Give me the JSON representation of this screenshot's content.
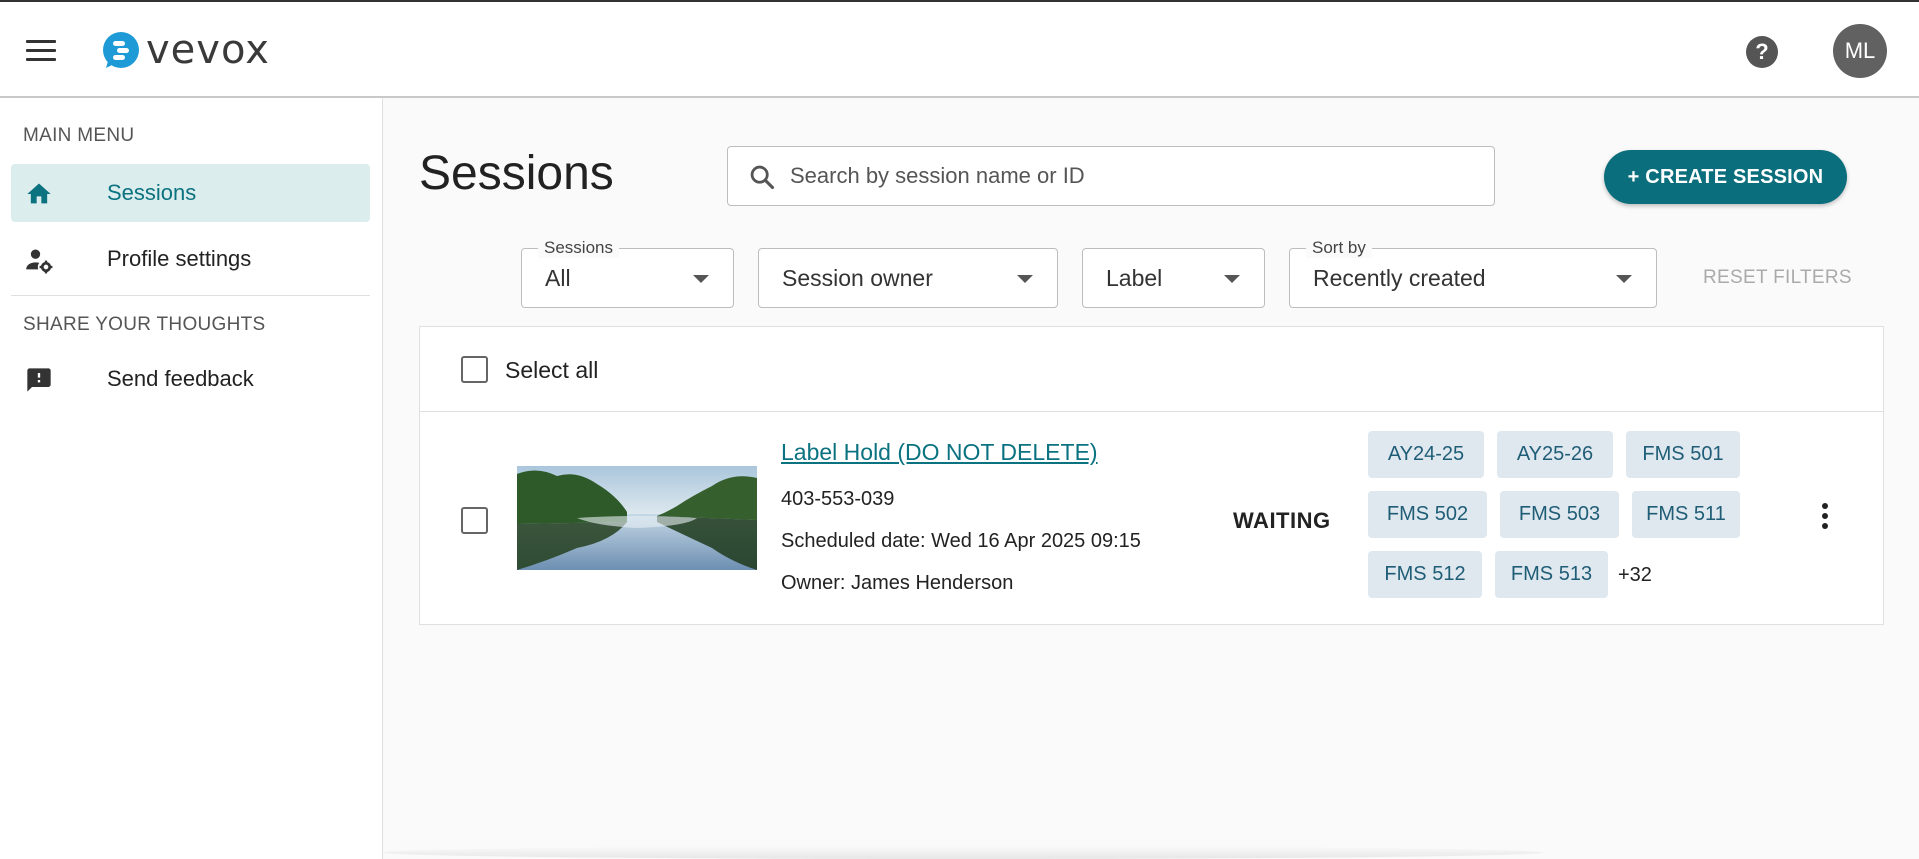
{
  "header": {
    "logo_text": "vevox",
    "help_symbol": "?",
    "avatar_initials": "ML",
    "brand_color": "#0b6e7c"
  },
  "sidebar": {
    "main_menu_title": "MAIN MENU",
    "items": [
      {
        "label": "Sessions",
        "icon": "home-icon",
        "active": true
      },
      {
        "label": "Profile settings",
        "icon": "user-settings-icon",
        "active": false
      }
    ],
    "share_title": "SHARE YOUR THOUGHTS",
    "feedback": {
      "label": "Send feedback",
      "icon": "feedback-icon"
    }
  },
  "main": {
    "title": "Sessions",
    "search_placeholder": "Search by session name or ID",
    "create_label": "+ CREATE SESSION",
    "filters": {
      "sessions": {
        "legend": "Sessions",
        "value": "All"
      },
      "owner": {
        "value": "Session owner"
      },
      "label": {
        "value": "Label"
      },
      "sort": {
        "legend": "Sort by",
        "value": "Recently created"
      },
      "reset_label": "RESET FILTERS"
    },
    "select_all_label": "Select all",
    "sessions": [
      {
        "name": "Label Hold (DO NOT DELETE)",
        "id": "403-553-039",
        "scheduled": "Scheduled date: Wed 16 Apr 2025 09:15",
        "owner": "Owner: James Henderson",
        "status": "WAITING",
        "labels": [
          "AY24-25",
          "AY25-26",
          "FMS 501",
          "FMS 502",
          "FMS 503",
          "FMS 511",
          "FMS 512",
          "FMS 513"
        ],
        "more_labels": "+32"
      }
    ]
  }
}
